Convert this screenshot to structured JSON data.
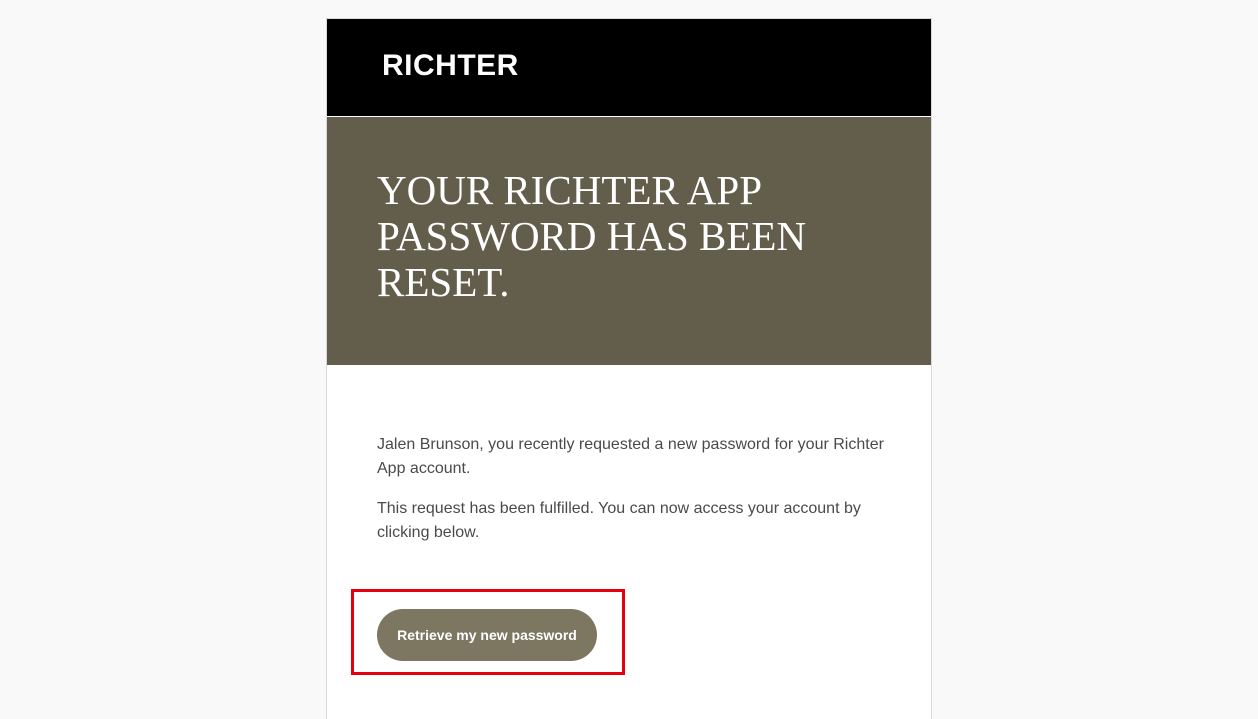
{
  "header": {
    "logo_text": "RICHTER"
  },
  "hero": {
    "title": "YOUR RICHTER APP PASSWORD HAS BEEN RESET."
  },
  "body": {
    "paragraph_1": "Jalen Brunson, you recently requested a new password for your Richter App account.",
    "paragraph_2": "This request has been fulfilled. You can now access your account by clicking below."
  },
  "cta": {
    "label": "Retrieve my new password"
  },
  "colors": {
    "header_bg": "#000000",
    "hero_bg": "#625e4b",
    "button_bg": "#7d7660",
    "highlight_border": "#e3000f",
    "page_bg": "#f9f9f9"
  }
}
